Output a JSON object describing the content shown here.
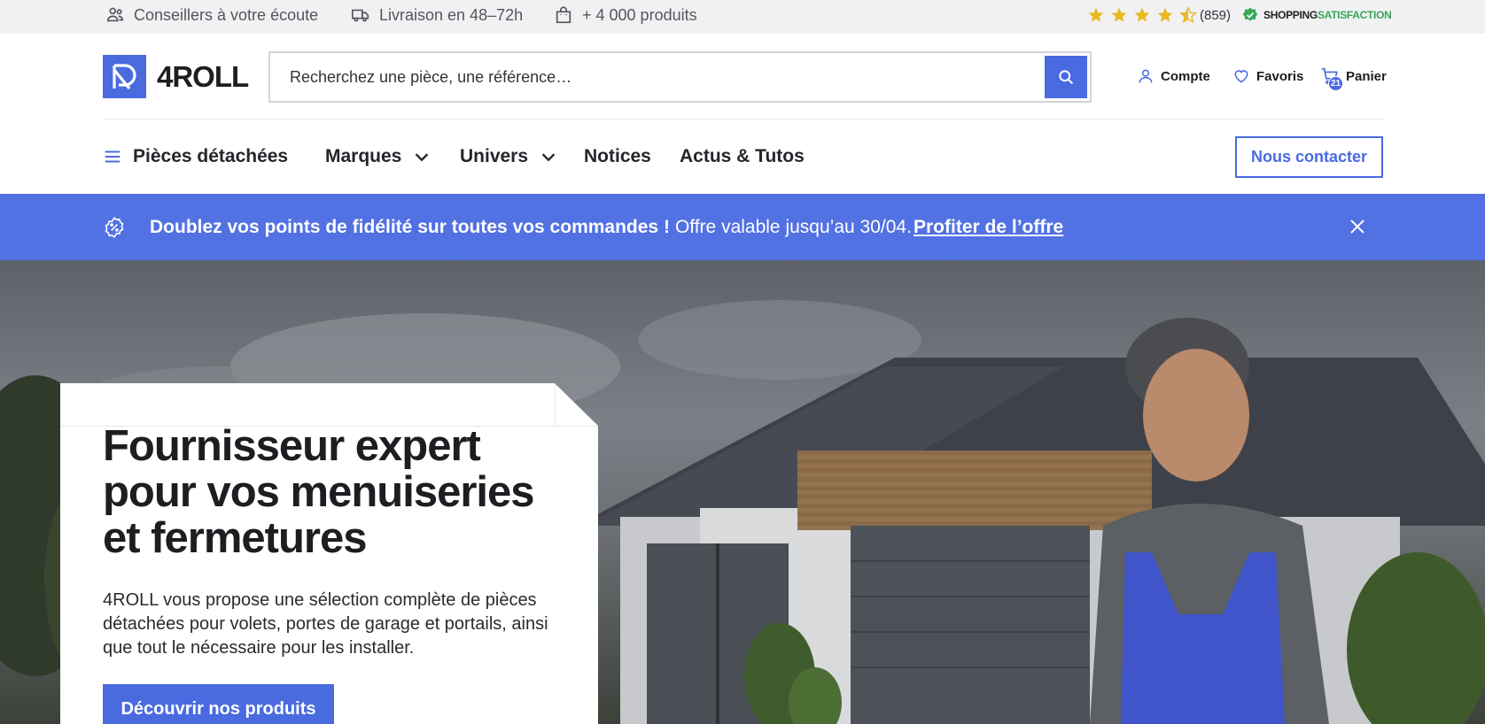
{
  "topbar": {
    "advisors": "Conseillers à votre écoute",
    "delivery": "Livraison en 48–72h",
    "products": "+ 4 000 produits",
    "rating_stars": 4.5,
    "reviews_count": "(859)",
    "badge_part1": "SHOPPING",
    "badge_part2": "SATISFACTION"
  },
  "header": {
    "logo_text": "4ROLL",
    "search_placeholder": "Recherchez une pièce, une référence…",
    "account_label": "Compte",
    "favorites_label": "Favoris",
    "cart_label": "Panier",
    "cart_count": "21"
  },
  "nav": {
    "parts": "Pièces détachées",
    "brands": "Marques",
    "universe": "Univers",
    "notices": "Notices",
    "news": "Actus & Tutos",
    "contact": "Nous contacter"
  },
  "promo": {
    "headline": "Doublez vos points de fidélité sur toutes vos commandes !",
    "validity": "Offre valable jusqu’au 30/04.",
    "link": "Profiter de l’offre"
  },
  "hero": {
    "title": "Fournisseur expert pour vos menuiseries et fermetures",
    "description": "4ROLL vous propose une sélection complète de pièces détachées pour volets, portes de garage et portails, ainsi que tout le nécessaire pour les installer.",
    "cta": "Découvrir nos produits"
  },
  "colors": {
    "accent": "#4a6ae0",
    "promo_bg": "#5271e2",
    "star": "#e8b923",
    "topbar_bg": "#f1f1f3"
  },
  "icons": [
    "advisors-icon",
    "truck-icon",
    "bag-icon",
    "star-icon",
    "shield-check-icon",
    "search-icon",
    "user-icon",
    "heart-icon",
    "cart-icon",
    "menu-icon",
    "chevron-down-icon",
    "badge-percent-icon",
    "close-icon"
  ]
}
